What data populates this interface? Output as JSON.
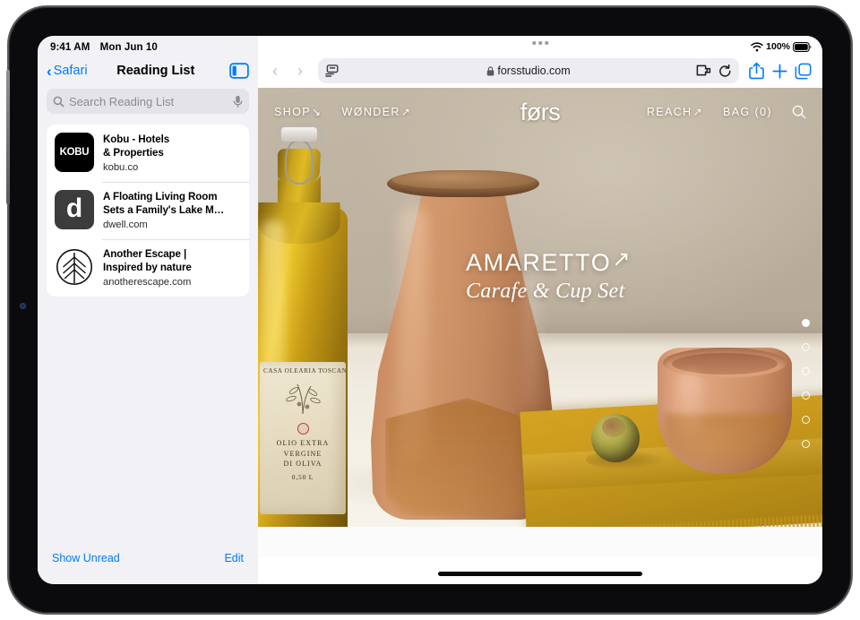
{
  "status_bar": {
    "time": "9:41 AM",
    "date": "Mon Jun 10",
    "battery_percent": "100%",
    "wifi_icon": "wifi-icon",
    "battery_icon": "battery-full-icon"
  },
  "sidebar": {
    "back_label": "Safari",
    "title": "Reading List",
    "toggle_icon": "sidebar-toggle-icon",
    "search": {
      "placeholder": "Search Reading List",
      "value": "",
      "search_icon": "search-icon",
      "mic_icon": "microphone-icon"
    },
    "items": [
      {
        "title": "Kobu - Hotels\n& Properties",
        "title_line1": "Kobu - Hotels",
        "title_line2": "& Properties",
        "url": "kobu.co",
        "thumb_text": "KOBU",
        "thumb_type": "wordmark-dark"
      },
      {
        "title_line1": "A Floating Living Room",
        "title_line2": "Sets a Family's Lake M…",
        "url": "dwell.com",
        "thumb_text": "d",
        "thumb_type": "letter-dark"
      },
      {
        "title_line1": "Another Escape |",
        "title_line2": "Inspired by nature",
        "url": "anotherescape.com",
        "thumb_text": "",
        "thumb_type": "leaf-logo"
      }
    ],
    "footer": {
      "show_unread": "Show Unread",
      "edit": "Edit"
    }
  },
  "browser": {
    "multitask_icon": "multitasking-dots-icon",
    "back_icon": "chevron-left-icon",
    "forward_icon": "chevron-right-icon",
    "page_settings_icon": "page-settings-icon",
    "lock_icon": "lock-icon",
    "url": "forsstudio.com",
    "extension_icon": "extension-puzzle-icon",
    "reload_icon": "reload-icon",
    "share_icon": "share-icon",
    "new_tab_icon": "plus-icon",
    "tabs_icon": "tab-overview-icon"
  },
  "webpage": {
    "nav": {
      "shop": "SHOP",
      "shop_arrow": "↘",
      "wonder": "WØNDER",
      "wonder_arrow": "↗",
      "brand": "førs",
      "reach": "REACH",
      "reach_arrow": "↗",
      "bag": "BAG (0)",
      "search_icon": "search-icon"
    },
    "hero": {
      "title": "AMARETTO",
      "title_arrow": "↗",
      "subtitle": "Carafe & Cup Set",
      "carousel": {
        "total": 6,
        "active_index": 0
      }
    }
  },
  "colors": {
    "accent_blue": "#007aff",
    "sidebar_bg": "#f1f1f6",
    "hero_wall": "#bdb1a0",
    "terracotta": "#d49a6e",
    "cloth_yellow": "#c99a1d"
  }
}
